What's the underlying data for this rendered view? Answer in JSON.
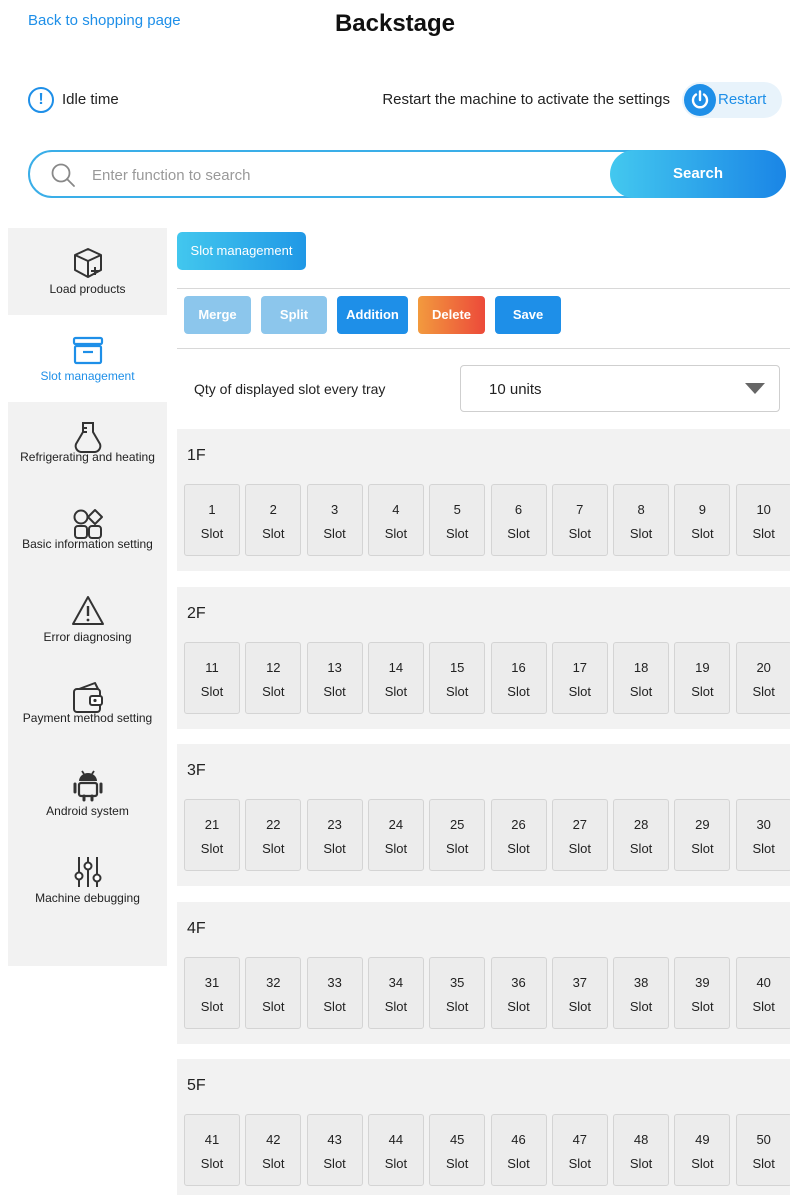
{
  "header": {
    "back_link": "Back to shopping page",
    "title": "Backstage"
  },
  "status": {
    "idle_label": "Idle time",
    "restart_hint": "Restart the machine to activate the settings",
    "restart_label": "Restart"
  },
  "search": {
    "placeholder": "Enter function to search",
    "value": "",
    "button_label": "Search"
  },
  "sidebar": {
    "items": [
      {
        "label": "Load products",
        "icon": "box-plus-icon",
        "active": false
      },
      {
        "label": "Slot management",
        "icon": "tray-icon",
        "active": true
      },
      {
        "label": "Refrigerating and heating",
        "icon": "flask-icon",
        "active": false
      },
      {
        "label": "Basic information setting",
        "icon": "grid-shapes-icon",
        "active": false
      },
      {
        "label": "Error diagnosing",
        "icon": "warning-icon",
        "active": false
      },
      {
        "label": "Payment method setting",
        "icon": "wallet-icon",
        "active": false
      },
      {
        "label": "Android system",
        "icon": "android-icon",
        "active": false
      },
      {
        "label": "Machine debugging",
        "icon": "sliders-icon",
        "active": false
      }
    ]
  },
  "main": {
    "tab_label": "Slot management",
    "actions": {
      "merge": "Merge",
      "split": "Split",
      "addition": "Addition",
      "delete": "Delete",
      "save": "Save"
    },
    "qty_label": "Qty of displayed slot every tray",
    "qty_value": "10 units",
    "slot_word": "Slot",
    "trays": [
      {
        "name": "1F",
        "slots": [
          "1",
          "2",
          "3",
          "4",
          "5",
          "6",
          "7",
          "8",
          "9",
          "10"
        ]
      },
      {
        "name": "2F",
        "slots": [
          "11",
          "12",
          "13",
          "14",
          "15",
          "16",
          "17",
          "18",
          "19",
          "20"
        ]
      },
      {
        "name": "3F",
        "slots": [
          "21",
          "22",
          "23",
          "24",
          "25",
          "26",
          "27",
          "28",
          "29",
          "30"
        ]
      },
      {
        "name": "4F",
        "slots": [
          "31",
          "32",
          "33",
          "34",
          "35",
          "36",
          "37",
          "38",
          "39",
          "40"
        ]
      },
      {
        "name": "5F",
        "slots": [
          "41",
          "42",
          "43",
          "44",
          "45",
          "46",
          "47",
          "48",
          "49",
          "50"
        ]
      }
    ]
  },
  "colors": {
    "accent": "#1e8fe8",
    "accent_light": "#43c8ef",
    "delete": "#ec4a3a",
    "disabled_button": "#8cc6ec",
    "panel_bg": "#f2f2f2"
  }
}
